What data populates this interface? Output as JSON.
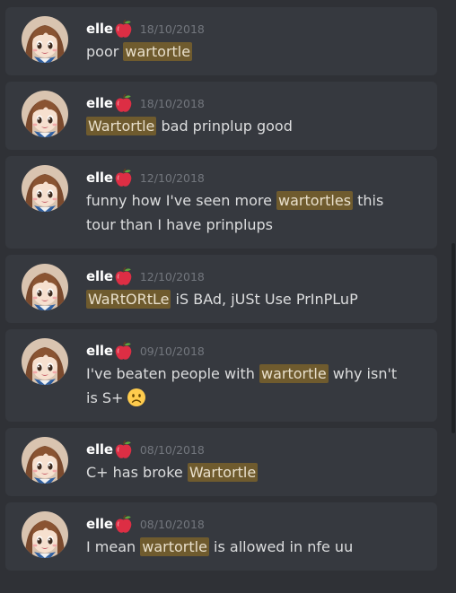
{
  "messages": [
    {
      "author": "elle",
      "timestamp": "18/10/2018",
      "parts": [
        {
          "text": "poor "
        },
        {
          "text": "wartortle",
          "highlight": true
        }
      ]
    },
    {
      "author": "elle",
      "timestamp": "18/10/2018",
      "parts": [
        {
          "text": "Wartortle",
          "highlight": true
        },
        {
          "text": " bad prinplup good"
        }
      ]
    },
    {
      "author": "elle",
      "timestamp": "12/10/2018",
      "parts": [
        {
          "text": "funny how I've seen more "
        },
        {
          "text": "wartortles",
          "highlight": true
        },
        {
          "text": " this tour than I have prinplups"
        }
      ]
    },
    {
      "author": "elle",
      "timestamp": "12/10/2018",
      "parts": [
        {
          "text": "WaRtORtLe",
          "highlight": true
        },
        {
          "text": " iS BAd, jUSt Use PrInPLuP"
        }
      ]
    },
    {
      "author": "elle",
      "timestamp": "09/10/2018",
      "parts": [
        {
          "text": "I've beaten people with "
        },
        {
          "text": "wartortle",
          "highlight": true
        },
        {
          "text": " why isn't is S+"
        }
      ],
      "emoji": "frowning-face-emoji"
    },
    {
      "author": "elle",
      "timestamp": "08/10/2018",
      "parts": [
        {
          "text": "C+ has broke "
        },
        {
          "text": "Wartortle",
          "highlight": true
        }
      ]
    },
    {
      "author": "elle",
      "timestamp": "08/10/2018",
      "parts": [
        {
          "text": "I mean "
        },
        {
          "text": "wartortle",
          "highlight": true
        },
        {
          "text": " is allowed in nfe uu"
        }
      ]
    }
  ],
  "icons": {
    "name_badge": "apple-icon",
    "avatar": "user-avatar"
  },
  "colors": {
    "background": "#2f3136",
    "card": "#36393f",
    "highlight": "#6f5b2e",
    "text": "#dcddde",
    "timestamp": "#72767d"
  }
}
